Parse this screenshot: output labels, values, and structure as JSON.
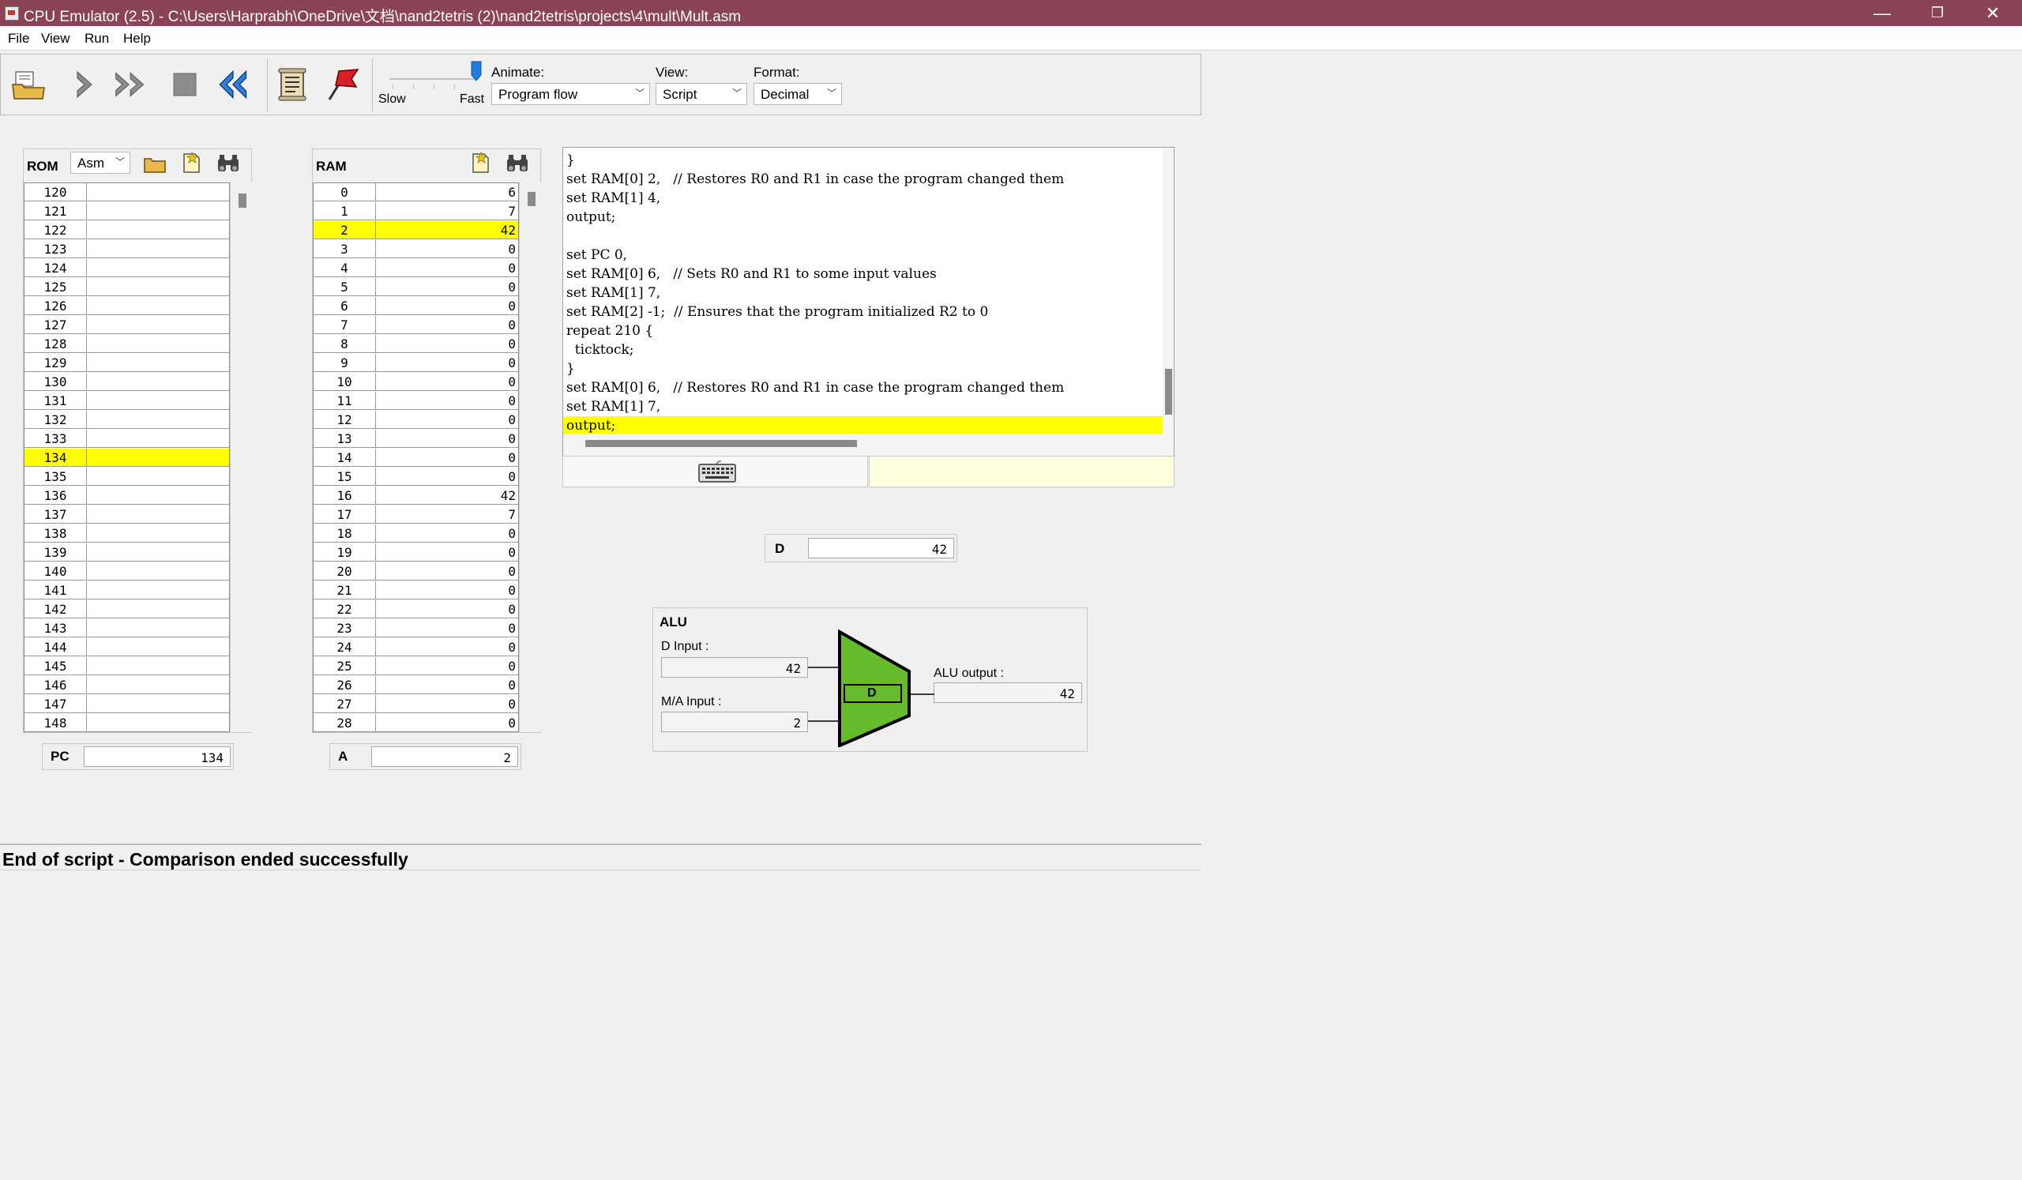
{
  "window": {
    "title": "CPU Emulator (2.5) - C:\\Users\\Harprabh\\OneDrive\\文档\\nand2tetris (2)\\nand2tetris\\projects\\4\\mult\\Mult.asm",
    "minimize": "—",
    "restore": "❐",
    "close": "✕"
  },
  "menu": [
    "File",
    "View",
    "Run",
    "Help"
  ],
  "toolbar": {
    "buttons": [
      "load-program-icon",
      "single-step-icon",
      "run-icon",
      "stop-icon",
      "reset-icon",
      "load-script-icon",
      "breakpoints-icon"
    ],
    "speed_slow": "Slow",
    "speed_fast": "Fast",
    "speed_level": 1.0,
    "animate_label": "Animate:",
    "animate_value": "Program flow",
    "view_label": "View:",
    "view_value": "Script",
    "format_label": "Format:",
    "format_value": "Decimal"
  },
  "rom": {
    "title": "ROM",
    "format_value": "Asm",
    "highlight_row": 134,
    "rows": [
      {
        "addr": "120",
        "val": ""
      },
      {
        "addr": "121",
        "val": ""
      },
      {
        "addr": "122",
        "val": ""
      },
      {
        "addr": "123",
        "val": ""
      },
      {
        "addr": "124",
        "val": ""
      },
      {
        "addr": "125",
        "val": ""
      },
      {
        "addr": "126",
        "val": ""
      },
      {
        "addr": "127",
        "val": ""
      },
      {
        "addr": "128",
        "val": ""
      },
      {
        "addr": "129",
        "val": ""
      },
      {
        "addr": "130",
        "val": ""
      },
      {
        "addr": "131",
        "val": ""
      },
      {
        "addr": "132",
        "val": ""
      },
      {
        "addr": "133",
        "val": ""
      },
      {
        "addr": "134",
        "val": ""
      },
      {
        "addr": "135",
        "val": ""
      },
      {
        "addr": "136",
        "val": ""
      },
      {
        "addr": "137",
        "val": ""
      },
      {
        "addr": "138",
        "val": ""
      },
      {
        "addr": "139",
        "val": ""
      },
      {
        "addr": "140",
        "val": ""
      },
      {
        "addr": "141",
        "val": ""
      },
      {
        "addr": "142",
        "val": ""
      },
      {
        "addr": "143",
        "val": ""
      },
      {
        "addr": "144",
        "val": ""
      },
      {
        "addr": "145",
        "val": ""
      },
      {
        "addr": "146",
        "val": ""
      },
      {
        "addr": "147",
        "val": ""
      },
      {
        "addr": "148",
        "val": ""
      }
    ]
  },
  "pc": {
    "label": "PC",
    "value": "134"
  },
  "ram": {
    "title": "RAM",
    "highlight_row": 2,
    "rows": [
      {
        "addr": "0",
        "val": "6"
      },
      {
        "addr": "1",
        "val": "7"
      },
      {
        "addr": "2",
        "val": "42"
      },
      {
        "addr": "3",
        "val": "0"
      },
      {
        "addr": "4",
        "val": "0"
      },
      {
        "addr": "5",
        "val": "0"
      },
      {
        "addr": "6",
        "val": "0"
      },
      {
        "addr": "7",
        "val": "0"
      },
      {
        "addr": "8",
        "val": "0"
      },
      {
        "addr": "9",
        "val": "0"
      },
      {
        "addr": "10",
        "val": "0"
      },
      {
        "addr": "11",
        "val": "0"
      },
      {
        "addr": "12",
        "val": "0"
      },
      {
        "addr": "13",
        "val": "0"
      },
      {
        "addr": "14",
        "val": "0"
      },
      {
        "addr": "15",
        "val": "0"
      },
      {
        "addr": "16",
        "val": "42"
      },
      {
        "addr": "17",
        "val": "7"
      },
      {
        "addr": "18",
        "val": "0"
      },
      {
        "addr": "19",
        "val": "0"
      },
      {
        "addr": "20",
        "val": "0"
      },
      {
        "addr": "21",
        "val": "0"
      },
      {
        "addr": "22",
        "val": "0"
      },
      {
        "addr": "23",
        "val": "0"
      },
      {
        "addr": "24",
        "val": "0"
      },
      {
        "addr": "25",
        "val": "0"
      },
      {
        "addr": "26",
        "val": "0"
      },
      {
        "addr": "27",
        "val": "0"
      },
      {
        "addr": "28",
        "val": "0"
      }
    ]
  },
  "a": {
    "label": "A",
    "value": "2"
  },
  "script": {
    "highlight_line": 13,
    "lines": [
      "}",
      "set RAM[0] 2,   // Restores R0 and R1 in case the program changed them",
      "set RAM[1] 4,",
      "output;",
      "",
      "set PC 0,",
      "set RAM[0] 6,   // Sets R0 and R1 to some input values",
      "set RAM[1] 7,",
      "set RAM[2] -1;  // Ensures that the program initialized R2 to 0",
      "repeat 210 {",
      "  ticktock;",
      "}",
      "set RAM[0] 6,   // Restores R0 and R1 in case the program changed them",
      "output;"
    ],
    "line_12_extra": "set RAM[1] 7,"
  },
  "d": {
    "label": "D",
    "value": "42"
  },
  "alu": {
    "title": "ALU",
    "d_input_label": "D Input :",
    "d_input_value": "42",
    "ma_input_label": "M/A Input :",
    "ma_input_value": "2",
    "output_label": "ALU output :",
    "output_value": "42",
    "op_label": "D",
    "color": "#66bb2a"
  },
  "status": {
    "message": "End of script - Comparison ended successfully"
  }
}
